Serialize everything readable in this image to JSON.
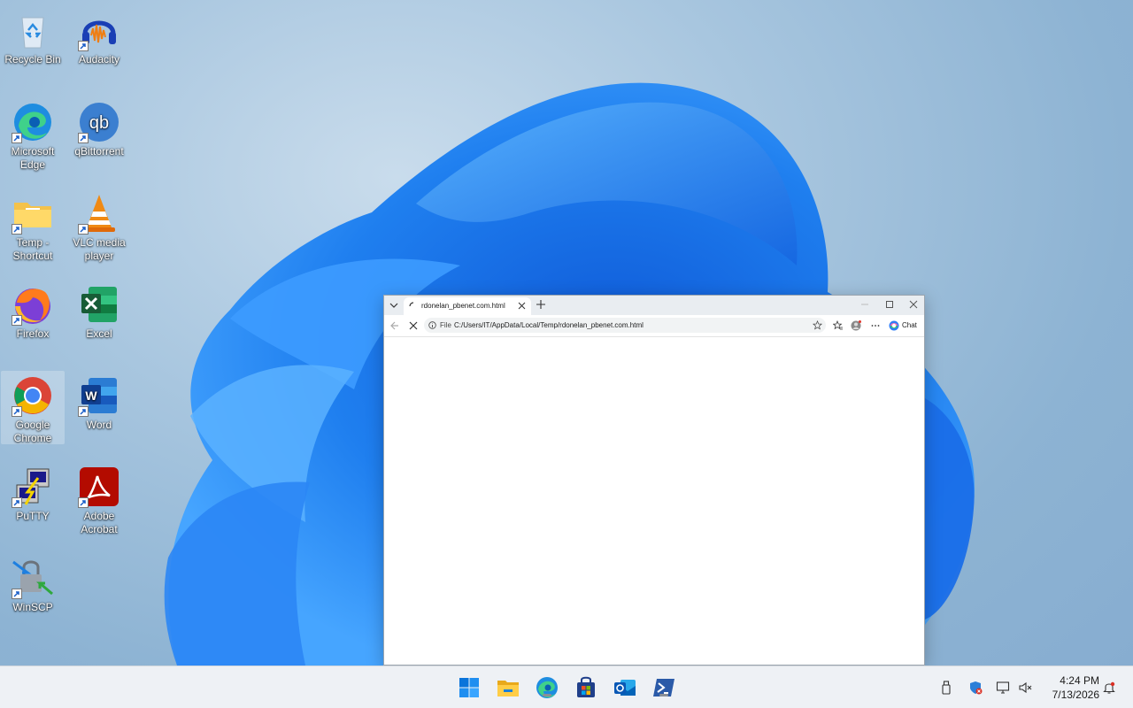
{
  "desktop": {
    "icons": [
      {
        "label": "Recycle Bin",
        "icon": "recycle-bin-icon"
      },
      {
        "label": "Audacity",
        "icon": "audacity-icon"
      },
      {
        "label": "Microsoft Edge",
        "icon": "edge-icon"
      },
      {
        "label": "qBittorrent",
        "icon": "qbittorrent-icon"
      },
      {
        "label": "Temp - Shortcut",
        "icon": "folder-icon"
      },
      {
        "label": "VLC media player",
        "icon": "vlc-icon"
      },
      {
        "label": "Firefox",
        "icon": "firefox-icon"
      },
      {
        "label": "Excel",
        "icon": "excel-icon"
      },
      {
        "label": "Google Chrome",
        "icon": "chrome-icon"
      },
      {
        "label": "Word",
        "icon": "word-icon"
      },
      {
        "label": "PuTTY",
        "icon": "putty-icon"
      },
      {
        "label": "Adobe Acrobat",
        "icon": "acrobat-icon"
      },
      {
        "label": "WinSCP",
        "icon": "winscp-icon"
      }
    ]
  },
  "browser": {
    "tab_title": "rdonelan_pbenet.com.html",
    "scheme": "File",
    "url": "C:/Users/IT/AppData/Local/Temp/rdonelan_pbenet.com.html",
    "copilot_label": "Chat"
  },
  "taskbar": {
    "apps": [
      "start-icon",
      "file-explorer-icon",
      "edge-icon",
      "store-icon",
      "outlook-icon",
      "powershell-icon"
    ],
    "clock": {
      "time": "4:24 PM",
      "date": "7/13/2026"
    }
  }
}
